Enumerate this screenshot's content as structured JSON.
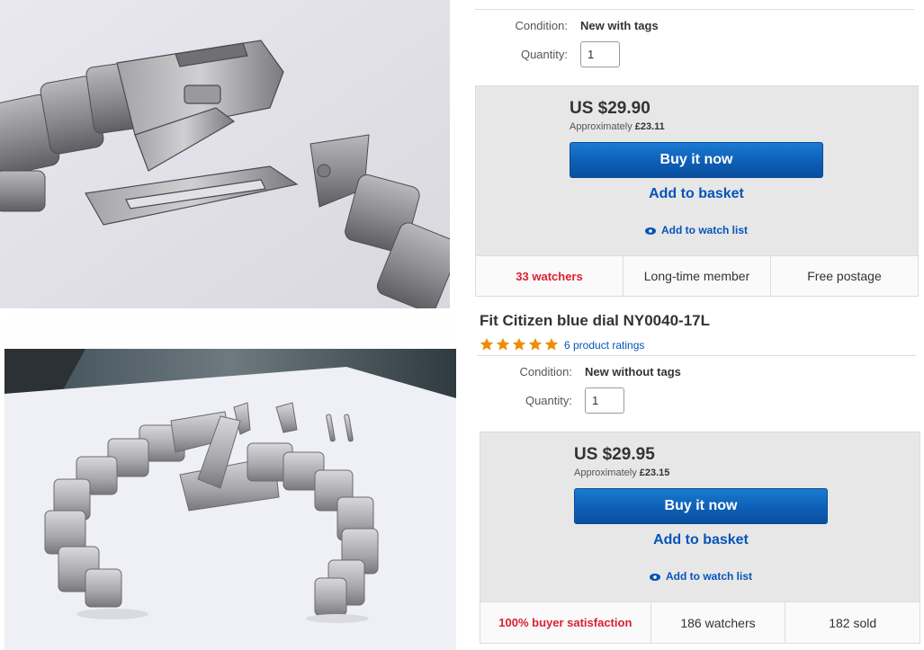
{
  "photos": [
    {
      "name": "bracelet-clasp-closeup",
      "description_icon": "photo-icon"
    },
    {
      "name": "bracelet-with-parts",
      "description_icon": "photo-icon"
    }
  ],
  "listings": [
    {
      "condition_label": "Condition:",
      "condition_value": "New with tags",
      "quantity_label": "Quantity:",
      "quantity_value": "1",
      "price": "US $29.90",
      "approx_label": "Approximately",
      "approx_value": "£23.11",
      "buy_now_label": "Buy it now",
      "add_basket_label": "Add to basket",
      "watch_list_label": "Add to watch list",
      "stats": [
        "33 watchers",
        "Long-time member",
        "Free postage"
      ]
    },
    {
      "title": "Fit Citizen blue dial NY0040-17L",
      "rating_stars": 5,
      "ratings_link": "6 product ratings",
      "condition_label": "Condition:",
      "condition_value": "New without tags",
      "quantity_label": "Quantity:",
      "quantity_value": "1",
      "price": "US $29.95",
      "approx_label": "Approximately",
      "approx_value": "£23.15",
      "buy_now_label": "Buy it now",
      "add_basket_label": "Add to basket",
      "watch_list_label": "Add to watch list",
      "stats": [
        "100% buyer satisfaction",
        "186 watchers",
        "182 sold"
      ]
    }
  ],
  "colors": {
    "link": "#0654ba",
    "button": "#0d5fb6",
    "alert": "#dd1e31",
    "star": "#f18c00",
    "buybox": "#e7e7e7"
  }
}
